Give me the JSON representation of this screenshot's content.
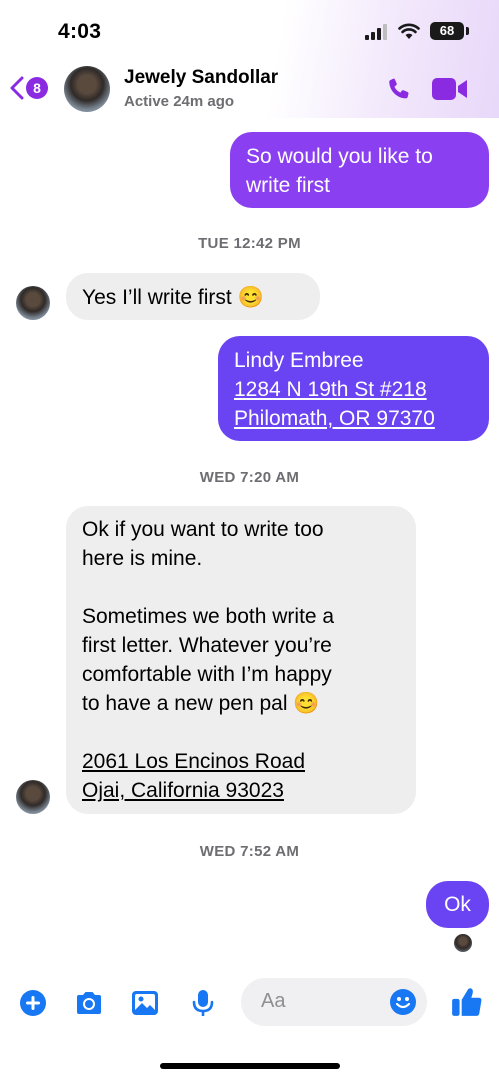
{
  "status": {
    "time": "4:03",
    "battery": "68"
  },
  "header": {
    "back_count": "8",
    "contact_name": "Jewely Sandollar",
    "contact_status": "Active 24m ago"
  },
  "messages": {
    "m1": {
      "lines": [
        "So would you like to",
        "write first"
      ]
    },
    "ts1": "TUE 12:42 PM",
    "m2": {
      "text": "Yes I’ll write first",
      "emoji": "😊"
    },
    "m3": {
      "lines": [
        "Lindy Embree",
        "1284 N 19th St #218",
        "Philomath, OR 97370"
      ]
    },
    "ts2": "WED 7:20 AM",
    "m4": {
      "lines": [
        "Ok if you want to write too",
        "here is mine.",
        "",
        "Sometimes we both write a",
        "first letter.  Whatever you’re",
        "comfortable with I’m happy",
        "to have a new pen pal",
        "",
        "2061 Los Encinos Road",
        "Ojai, California 93023"
      ],
      "emoji": "😊"
    },
    "ts3": "WED 7:52 AM",
    "m5": {
      "text": "Ok"
    }
  },
  "composer": {
    "placeholder": "Aa"
  },
  "colors": {
    "accent": "#8a2be2",
    "outgoing_purple": "#8a3ff0",
    "outgoing_blue": "#6a43f2",
    "incoming": "#eeeeef",
    "icon_blue": "#1877f2"
  },
  "icons": {
    "back": "chevron-left-icon",
    "call": "phone-icon",
    "video": "video-camera-icon",
    "add": "plus-circle-icon",
    "camera": "camera-icon",
    "gallery": "photo-icon",
    "mic": "microphone-icon",
    "emoji": "smiley-icon",
    "like": "thumbs-up-icon"
  }
}
